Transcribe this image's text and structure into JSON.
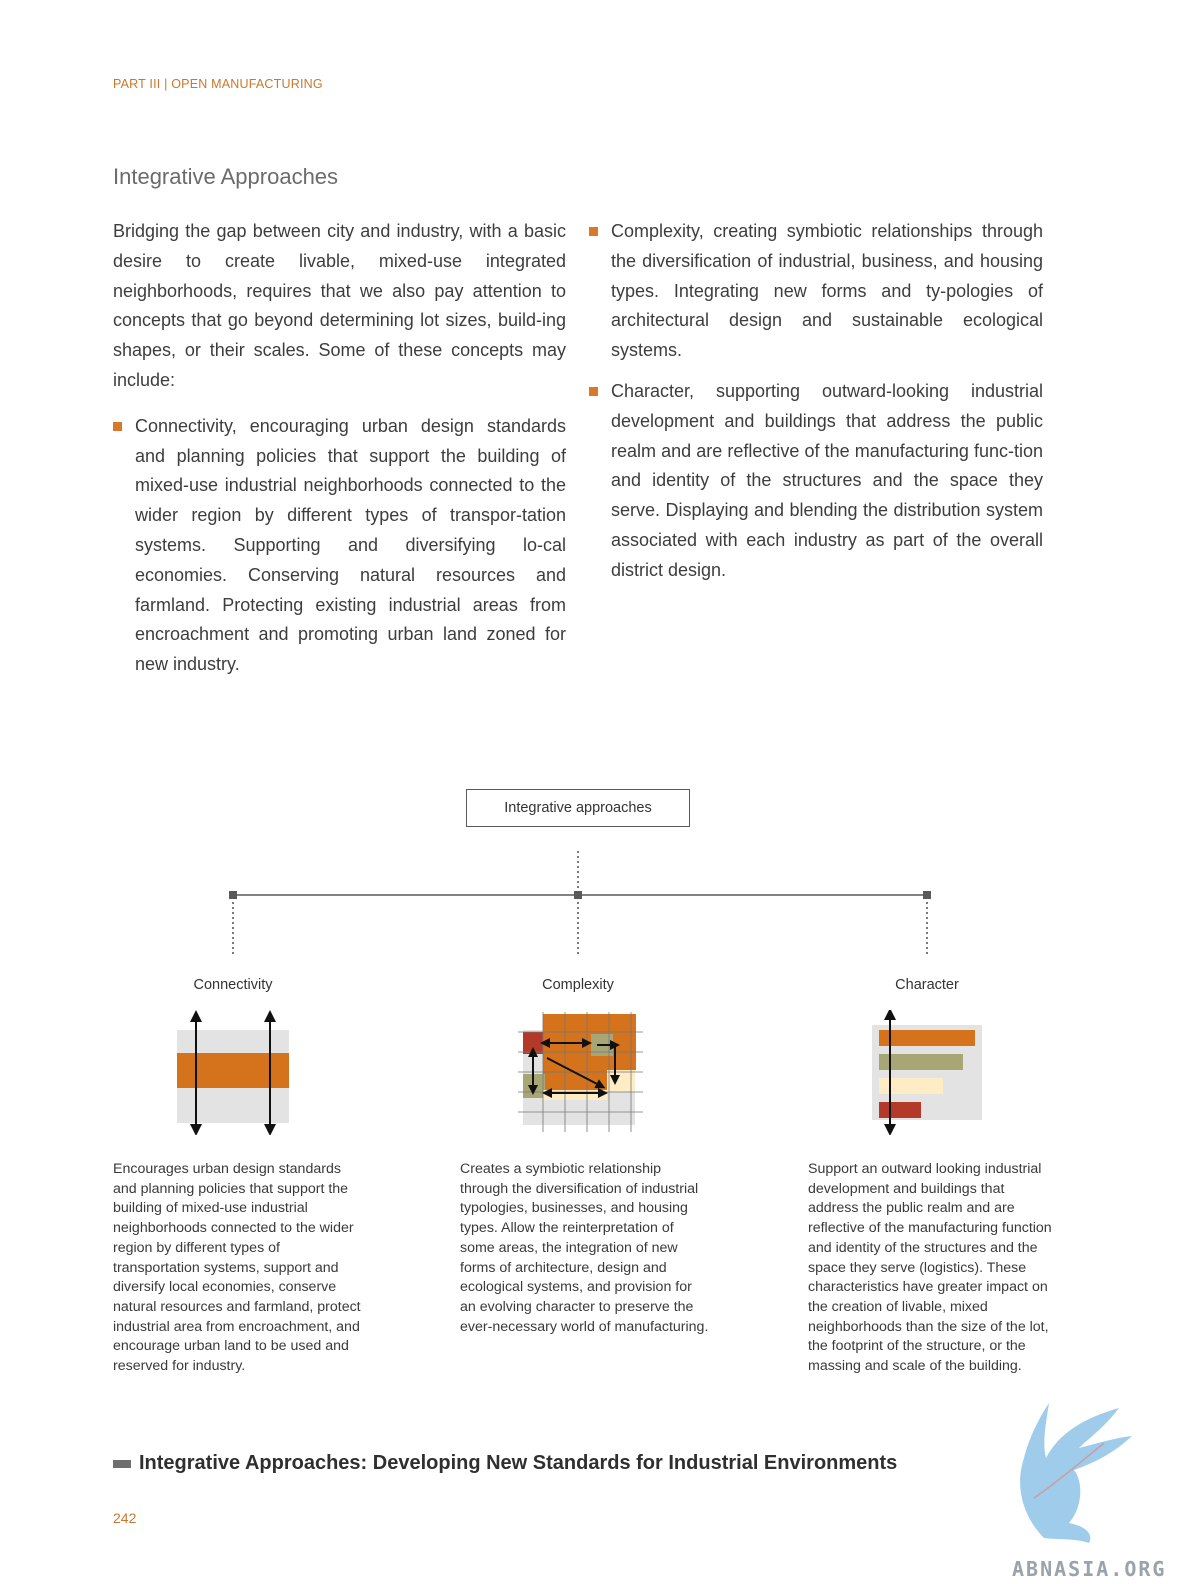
{
  "header": {
    "running_head": "PART III | OPEN MANUFACTURING"
  },
  "section": {
    "title": "Integrative Approaches",
    "intro": "Bridging the gap between city and industry, with a basic desire to create livable, mixed-use integrated neighborhoods, requires that we also pay attention to concepts that go beyond determining lot sizes, build-ing shapes, or their scales. Some of these concepts may include:",
    "bullets": [
      "Connectivity, encouraging urban design standards and planning policies that support the building of mixed-use industrial neighborhoods connected to the wider region by different types of transpor-tation systems. Supporting and diversifying lo-cal economies. Conserving natural resources and farmland. Protecting existing industrial areas from encroachment and promoting urban land zoned for new industry.",
      "Complexity, creating symbiotic relationships through the diversification of industrial, business, and housing types. Integrating new forms and ty-pologies of architectural design and sustainable ecological systems.",
      "Character, supporting outward-looking industrial development and buildings that address the public realm and are reflective of the manufacturing func-tion and identity of the structures and the space they serve. Displaying and blending the distribution system associated with each industry as part of the overall district design."
    ]
  },
  "diagram": {
    "root_label": "Integrative approaches",
    "colors": {
      "orange": "#d4731b",
      "olive": "#a9a676",
      "cream": "#fdecc4",
      "red": "#b33a28",
      "grey_bg": "#e3e3e3",
      "line": "#5a5a5a"
    },
    "branches": [
      {
        "label": "Connectivity",
        "icon": "connectivity-icon",
        "description": "Encourages urban design standards and planning policies that support the building of mixed-use industrial neighborhoods connected to the wider region by different types of transportation systems, support and diversify local economies, conserve natural resources and farmland, protect industrial area from encroachment, and encourage urban land to be used and reserved for industry."
      },
      {
        "label": "Complexity",
        "icon": "complexity-icon",
        "description": "Creates a symbiotic relationship through the diversification of industrial typologies, businesses, and housing types. Allow the reinterpretation of some areas, the integration of new forms of architecture, design and ecological systems, and provision for an evolving character to preserve the ever-necessary world of manufacturing."
      },
      {
        "label": "Character",
        "icon": "character-icon",
        "description": "Support an outward looking industrial development and buildings that address the public realm and are reflective of the manufacturing function and identity of the structures and the space they serve (logistics). These characteristics have greater impact on the creation of livable, mixed neighborhoods than the size of the lot, the footprint of the structure, or the massing and scale of the building."
      }
    ]
  },
  "caption": {
    "text": "Integrative Approaches: Developing New Standards for Industrial Environments"
  },
  "footer": {
    "page_number": "242"
  },
  "watermark": {
    "text": "ABNASIA.ORG",
    "icon": "griffin-logo-icon"
  }
}
